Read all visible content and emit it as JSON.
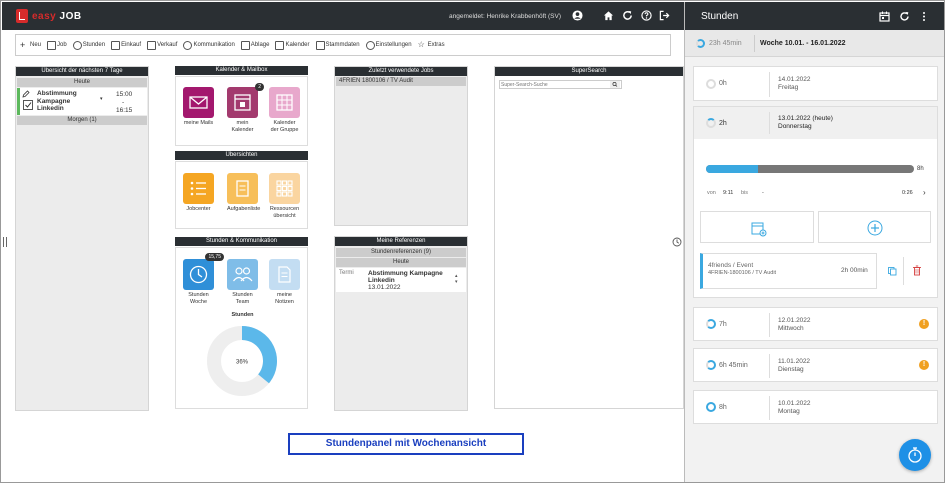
{
  "app": {
    "logo": "easy",
    "logo_accent": "JOB",
    "user": "angemeldet: Henrike Krabbenhöft (SV)"
  },
  "toolbar": [
    {
      "label": "Neu",
      "icon": "plus-icon"
    },
    {
      "label": "Job",
      "icon": "briefcase-icon"
    },
    {
      "label": "Stunden",
      "icon": "clock-icon"
    },
    {
      "label": "Einkauf",
      "icon": "document-icon"
    },
    {
      "label": "Verkauf",
      "icon": "document-icon"
    },
    {
      "label": "Kommunikation",
      "icon": "chat-icon"
    },
    {
      "label": "Ablage",
      "icon": "folder-icon"
    },
    {
      "label": "Kalender",
      "icon": "calendar-icon"
    },
    {
      "label": "Stammdaten",
      "icon": "database-icon"
    },
    {
      "label": "Einstellungen",
      "icon": "gear-icon"
    },
    {
      "label": "Extras",
      "icon": "star-icon"
    }
  ],
  "overview": {
    "title": "Übersicht der nächsten 7 Tage",
    "today": "Heute",
    "appointment": "Abstimmung Kampagne Linkedin",
    "time_start": "15:00",
    "time_sep": "-",
    "time_end": "16:15",
    "tomorrow": "Morgen (1)"
  },
  "calendar": {
    "title": "Kalender & Mailbox",
    "tiles": [
      {
        "label": "meine Mails",
        "color": "#a3186e",
        "badge": ""
      },
      {
        "label": "mein Kalender",
        "color": "#a33a6e",
        "badge": "2"
      },
      {
        "label": "Kalender der Gruppe",
        "color": "#e8a8cc",
        "badge": ""
      }
    ]
  },
  "lists": {
    "title": "Übersichten",
    "tiles": [
      {
        "label": "Jobcenter",
        "color": "#f5a623"
      },
      {
        "label": "Aufgabenliste",
        "color": "#f7bf5a"
      },
      {
        "label": "Ressourcen übersicht",
        "color": "#fad5a0"
      }
    ]
  },
  "hours_comm": {
    "title": "Stunden & Kommunikation",
    "tiles": [
      {
        "label": "Stunden Woche",
        "color": "#2f8fd8",
        "badge": "15,75"
      },
      {
        "label": "Stunden Team",
        "color": "#7fbde8",
        "badge": ""
      },
      {
        "label": "meine Notizen",
        "color": "#c3ddf2",
        "badge": ""
      }
    ],
    "chart_title": "Stunden",
    "chart_percent": "36%",
    "chart_value": 0.36
  },
  "recent_jobs": {
    "title": "Zuletzt verwendete Jobs",
    "item": "4FRIEN 1800106 / TV Audit"
  },
  "refs": {
    "title": "Meine Referenzen",
    "sub": "Stundenreferenzen (9)",
    "today": "Heute",
    "label": "Termi",
    "item_title": "Abstimmung Kampagne Linkedin",
    "item_date": "13.01.2022"
  },
  "search": {
    "title": "SuperSearch",
    "placeholder": "Super-Search-Suche"
  },
  "side": {
    "title": "Stunden",
    "week_total": "23h 45min",
    "week_range": "Woche 10.01. - 16.01.2022",
    "days": [
      {
        "hours": "0h",
        "date": "14.01.2022",
        "weekday": "Freitag",
        "warn": false
      },
      {
        "hours": "2h",
        "date": "13.01.2022 (heute)",
        "weekday": "Donnerstag",
        "warn": false
      },
      {
        "hours": "7h",
        "date": "12.01.2022",
        "weekday": "Mittwoch",
        "warn": true
      },
      {
        "hours": "6h 45min",
        "date": "11.01.2022",
        "weekday": "Dienstag",
        "warn": true
      },
      {
        "hours": "8h",
        "date": "10.01.2022",
        "weekday": "Montag",
        "warn": false
      }
    ],
    "progress_label": "8h",
    "progress_value": 0.25,
    "from_label": "von",
    "from_value": "9:11",
    "to_label": "bis",
    "to_value": "-",
    "duration": "0:26",
    "entry_title": "4friends / Event",
    "entry_job": "4FRIEN-1800106 / TV Audit",
    "entry_time": "2h 00min"
  },
  "caption": "Stundenpanel mit Wochenansicht",
  "colors": {
    "header": "#2a2f33",
    "accent": "#3aa8e0",
    "warn": "#f0a020",
    "caption": "#1a3fbf"
  }
}
